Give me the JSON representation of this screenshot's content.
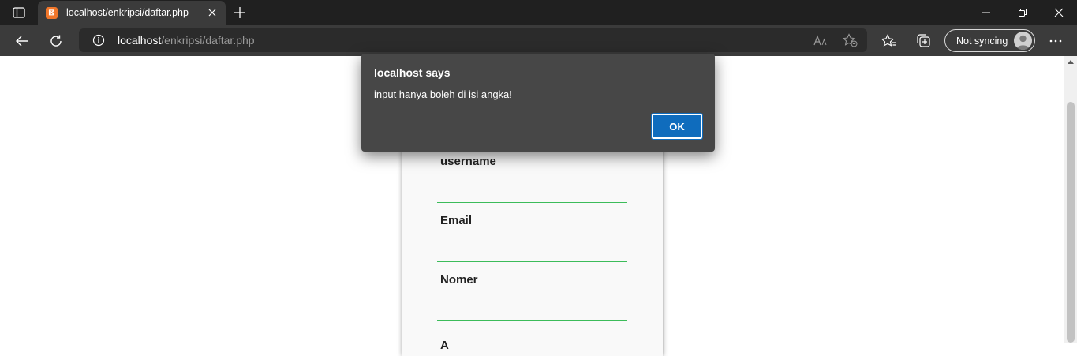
{
  "browser": {
    "tab": {
      "title": "localhost/enkripsi/daftar.php",
      "favicon_glyph": "⊠"
    },
    "address": {
      "host": "localhost",
      "path": "/enkripsi/daftar.php"
    },
    "sync_label": "Not syncing",
    "icons": [
      "tab-actions-icon",
      "close-icon",
      "new-tab-icon",
      "minimize-icon",
      "restore-icon",
      "close-window-icon",
      "back-icon",
      "refresh-icon",
      "info-icon",
      "read-aloud-icon",
      "add-favorite-icon",
      "favorites-icon",
      "collections-icon",
      "avatar",
      "more-icon"
    ]
  },
  "form": {
    "fields": [
      {
        "label": "username",
        "value": ""
      },
      {
        "label": "Email",
        "value": ""
      },
      {
        "label": "Nomer",
        "value": ""
      }
    ],
    "next_label_partial": "A"
  },
  "dialog": {
    "title": "localhost says",
    "message": "input hanya boleh di isi angka!",
    "ok_label": "OK"
  },
  "colors": {
    "accent": "#0f6cbd",
    "input_underline": "#3cbc5a",
    "chrome_dark": "#202020",
    "chrome_toolbar": "#3b3b3b",
    "favicon": "#f0762a"
  }
}
